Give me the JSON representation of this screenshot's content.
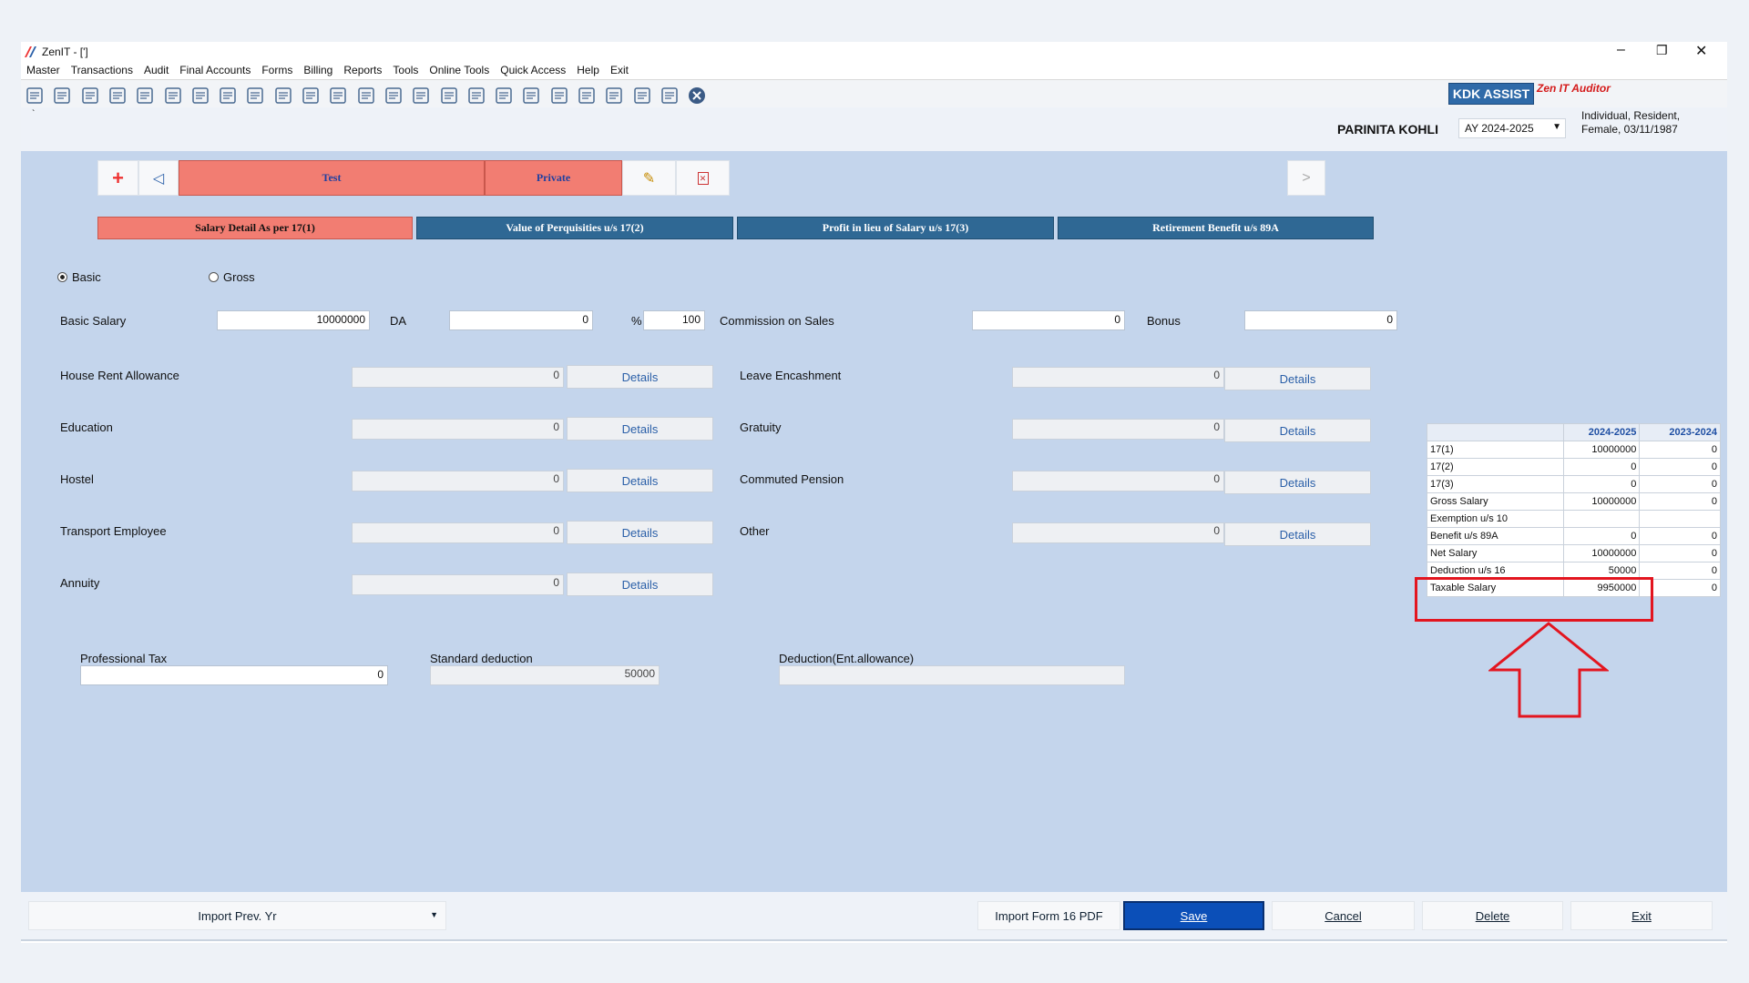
{
  "window": {
    "title": "ZenIT - [']"
  },
  "menu": [
    "Master",
    "Transactions",
    "Audit",
    "Final Accounts",
    "Forms",
    "Billing",
    "Reports",
    "Tools",
    "Online Tools",
    "Quick Access",
    "Help",
    "Exit"
  ],
  "toolbar_icons": [
    "open-icon",
    "home-icon",
    "ledger-icon",
    "chart-icon",
    "gift-icon",
    "users-icon",
    "hammer-icon",
    "filter-icon",
    "tax-icon",
    "eye-icon",
    "calculator-icon",
    "pie-icon",
    "pay-icon",
    "book-icon",
    "info-icon",
    "report-icon",
    "export-icon",
    "calendar-icon",
    "refresh-icon",
    "copy-icon",
    "card-icon",
    "people-icon",
    "cert-icon",
    "form-icon",
    "close-circle-icon"
  ],
  "brand": {
    "kdk": "KDK ASSIST",
    "auditor": "Zen IT Auditor"
  },
  "client": {
    "name": "PARINITA  KOHLI",
    "ay": "AY 2024-2025",
    "info_line1": "Individual, Resident,",
    "info_line2": "Female, 03/11/1987"
  },
  "records": {
    "add": "+",
    "prev": "◁",
    "employer": "Test",
    "type": "Private",
    "next": ">"
  },
  "tabs": [
    "Salary Detail As per 17(1)",
    "Value of Perquisities u/s 17(2)",
    "Profit in lieu of Salary u/s 17(3)",
    "Retirement Benefit u/s 89A"
  ],
  "radio": {
    "basic": "Basic",
    "gross": "Gross"
  },
  "row1": {
    "basic_label": "Basic Salary",
    "basic_value": "10000000",
    "da_label": "DA",
    "da_value": "0",
    "pct_label": "%",
    "pct_value": "100",
    "commission_label": "Commission on Sales",
    "commission_value": "0",
    "bonus_label": "Bonus",
    "bonus_value": "0"
  },
  "details_label": "Details",
  "left_fields": [
    {
      "label": "House Rent Allowance",
      "value": "0"
    },
    {
      "label": "Education",
      "value": "0"
    },
    {
      "label": "Hostel",
      "value": "0"
    },
    {
      "label": "Transport Employee",
      "value": "0"
    },
    {
      "label": "Annuity",
      "value": "0"
    }
  ],
  "right_fields": [
    {
      "label": "Leave Encashment",
      "value": "0"
    },
    {
      "label": "Gratuity",
      "value": "0"
    },
    {
      "label": "Commuted Pension",
      "value": "0"
    },
    {
      "label": "Other",
      "value": "0"
    }
  ],
  "deductions": {
    "prof_tax_label": "Professional Tax",
    "prof_tax_value": "0",
    "std_label": "Standard deduction",
    "std_value": "50000",
    "ent_label": "Deduction(Ent.allowance)",
    "ent_value": ""
  },
  "summary": {
    "headers": [
      "2024-2025",
      "2023-2024"
    ],
    "rows": [
      [
        "17(1)",
        "10000000",
        "0"
      ],
      [
        "17(2)",
        "0",
        "0"
      ],
      [
        "17(3)",
        "0",
        "0"
      ],
      [
        "Gross Salary",
        "10000000",
        "0"
      ],
      [
        "Exemption u/s 10",
        "",
        ""
      ],
      [
        "Benefit u/s 89A",
        "0",
        "0"
      ],
      [
        "Net Salary",
        "10000000",
        "0"
      ],
      [
        "Deduction u/s 16",
        "50000",
        "0"
      ],
      [
        "Taxable Salary",
        "9950000",
        "0"
      ]
    ]
  },
  "bottom": {
    "import_prev": "Import Prev. Yr",
    "import_f16": "Import Form 16 PDF",
    "save": "Save",
    "cancel": "Cancel",
    "delete": "Delete",
    "exit": "Exit"
  },
  "colors": {
    "highlight": "#e3151f",
    "save": "#0b4fb8",
    "tab_active": "#f27d72",
    "tab": "#2f6894"
  }
}
